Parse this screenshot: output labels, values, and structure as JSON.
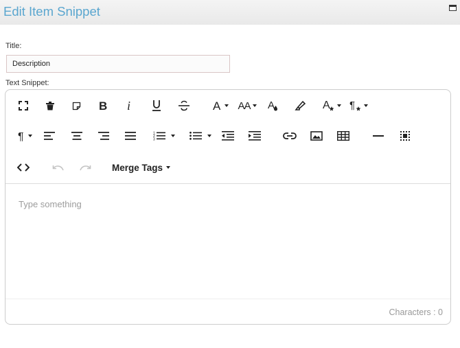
{
  "header": {
    "title": "Edit Item Snippet"
  },
  "form": {
    "title_label": "Title:",
    "title_value": "Description",
    "snippet_label": "Text Snippet:"
  },
  "editor": {
    "placeholder": "Type something",
    "merge_tags_label": "Merge Tags",
    "characters_label": "Characters : 0",
    "font_size_label": "AA",
    "toolbar_icons": [
      "fullscreen",
      "clear",
      "copy",
      "bold",
      "italic",
      "underline",
      "strikethrough",
      "font-family",
      "font-size",
      "text-color",
      "background-color",
      "inline-style",
      "paragraph-style",
      "paragraph-format",
      "align-left",
      "align-center",
      "align-right",
      "align-justify",
      "ordered-list",
      "unordered-list",
      "outdent",
      "indent",
      "insert-link",
      "insert-image",
      "insert-table",
      "insert-hr",
      "select-all",
      "html-view",
      "undo",
      "redo",
      "merge-tags"
    ]
  },
  "colors": {
    "title": "#5aa6cf",
    "border": "#cccccc",
    "placeholder": "#9c9c9c"
  }
}
